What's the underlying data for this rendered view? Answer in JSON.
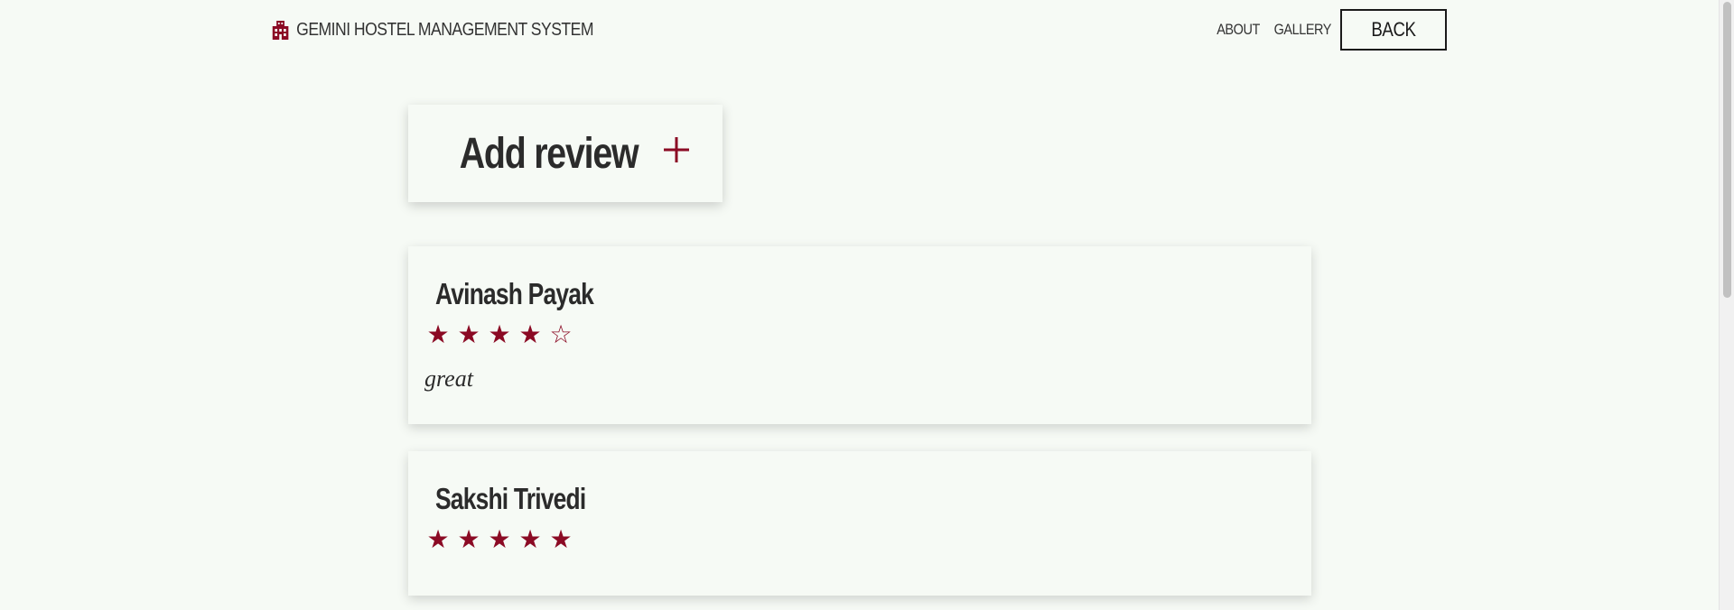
{
  "header": {
    "brand_icon": "building-icon",
    "brand_text": "GEMINI HOSTEL MANAGEMENT SYSTEM",
    "nav": {
      "about": "ABOUT",
      "gallery": "GALLERY",
      "back": "BACK"
    }
  },
  "add_review": {
    "title": "Add review",
    "icon": "plus-icon"
  },
  "colors": {
    "accent": "#8b0a24",
    "background": "#f6faf5",
    "text": "#2b2b2b"
  },
  "reviews": [
    {
      "name": "Avinash Payak",
      "rating": 4,
      "max_rating": 5,
      "stars": [
        "★",
        "★",
        "★",
        "★",
        "☆"
      ],
      "text": "great"
    },
    {
      "name": "Sakshi Trivedi",
      "rating": 5,
      "max_rating": 5,
      "stars": [
        "★",
        "★",
        "★",
        "★",
        "★"
      ],
      "text": ""
    }
  ]
}
